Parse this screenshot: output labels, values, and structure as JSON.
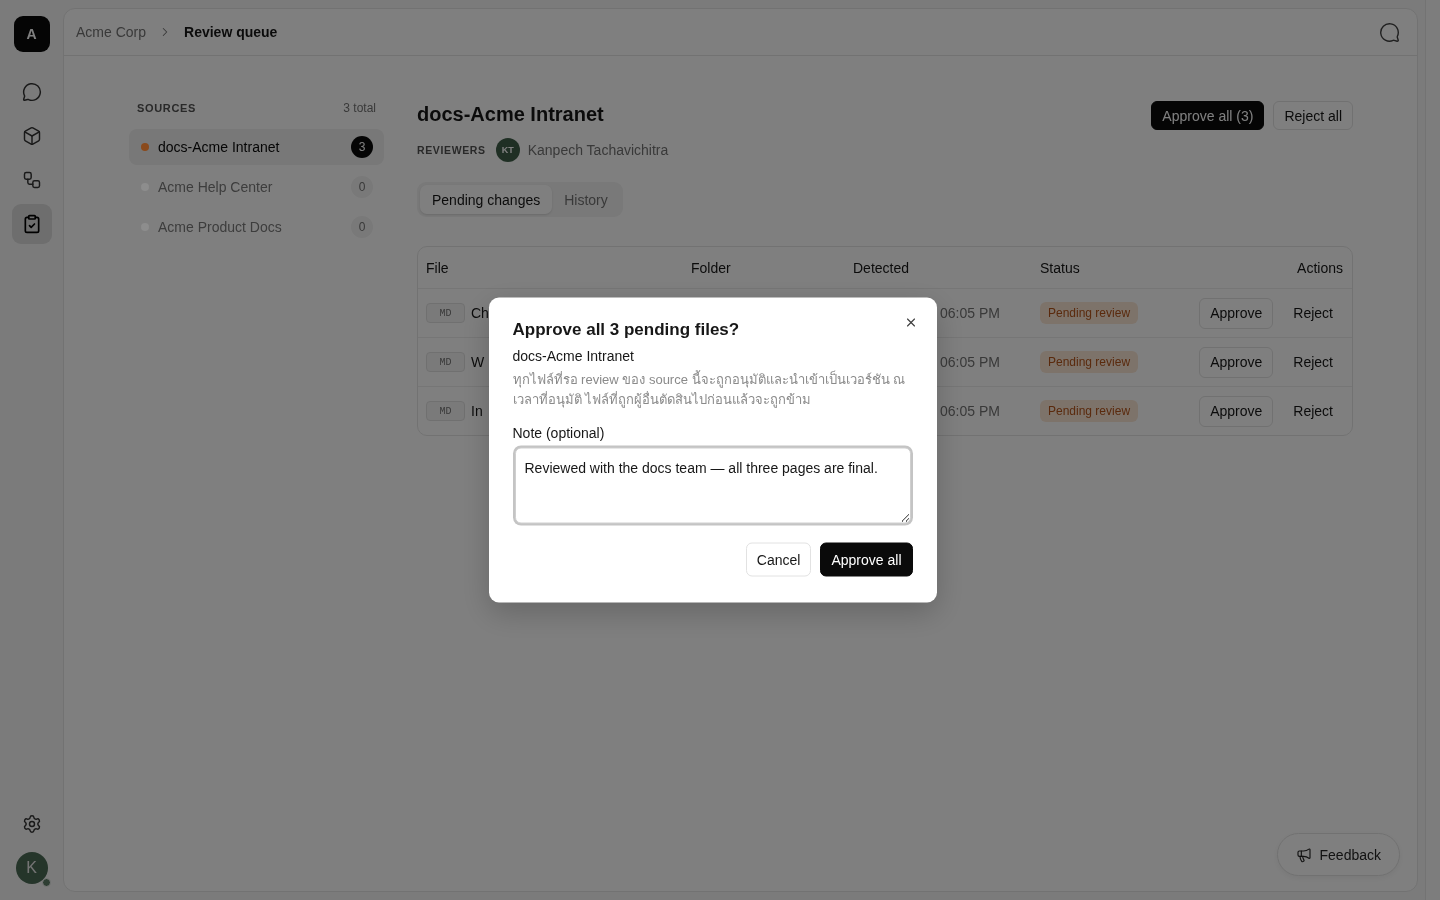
{
  "rail": {
    "logo": "A",
    "items": [
      {
        "selected": false
      },
      {
        "selected": false
      },
      {
        "selected": false
      },
      {
        "selected": true
      }
    ],
    "user": {
      "initial": "K",
      "online": true
    }
  },
  "breadcrumb": [
    {
      "label": "Acme Corp",
      "current": false
    },
    {
      "label": "Review queue",
      "current": true
    }
  ],
  "sources": {
    "heading": "SOURCES",
    "total": "3 total",
    "items": [
      {
        "name": "docs-Acme Intranet",
        "count": "3",
        "selected": true,
        "color": "#8a4a1c"
      },
      {
        "name": "Acme Help Center",
        "count": "0",
        "selected": false,
        "color": "#8d8d8d"
      },
      {
        "name": "Acme Product Docs",
        "count": "0",
        "selected": false,
        "color": "#8d8d8d"
      }
    ]
  },
  "detail": {
    "title": "docs-Acme Intranet",
    "reviewers_label": "REVIEWERS",
    "reviewers": [
      {
        "initials": "KT",
        "name": "Kanpech Tachavichitra"
      }
    ],
    "actions": [
      {
        "label": "Approve all (3)",
        "kind": "primary"
      },
      {
        "label": "Reject all",
        "kind": "secondary"
      }
    ],
    "tabs": [
      {
        "label": "Pending changes",
        "selected": true
      },
      {
        "label": "History",
        "selected": false
      }
    ],
    "table": {
      "columns": [
        "File",
        "Folder",
        "Detected",
        "Status",
        "Actions"
      ],
      "rows": [
        {
          "type": "MD",
          "file": "Ch",
          "detected": "06:05 PM",
          "status": "Pending review",
          "actions": [
            {
              "label": "Approve",
              "kind": "outline"
            },
            {
              "label": "Reject",
              "kind": "ghost"
            }
          ]
        },
        {
          "type": "MD",
          "file": "W",
          "detected": "06:05 PM",
          "status": "Pending review",
          "actions": [
            {
              "label": "Approve",
              "kind": "outline"
            },
            {
              "label": "Reject",
              "kind": "ghost"
            }
          ]
        },
        {
          "type": "MD",
          "file": "In",
          "detected": "06:05 PM",
          "status": "Pending review",
          "actions": [
            {
              "label": "Approve",
              "kind": "outline"
            },
            {
              "label": "Reject",
              "kind": "ghost"
            }
          ]
        }
      ]
    }
  },
  "dialog": {
    "title": "Approve all 3 pending files?",
    "subtitle": "docs-Acme Intranet",
    "description": "ทุกไฟล์ที่รอ review ของ source นี้จะถูกอนุมัติและนำเข้าเป็นเวอร์ชัน ณ เวลาที่อนุมัติ ไฟล์ที่ถูกผู้อื่นตัดสินไปก่อนแล้วจะถูกข้าม",
    "note": {
      "label": "Note (optional)",
      "value": "Reviewed with the docs team — all three pages are final."
    },
    "buttons": [
      {
        "label": "Cancel",
        "kind": "secondary"
      },
      {
        "label": "Approve all",
        "kind": "primary"
      }
    ]
  },
  "feedback": {
    "label": "Feedback"
  }
}
